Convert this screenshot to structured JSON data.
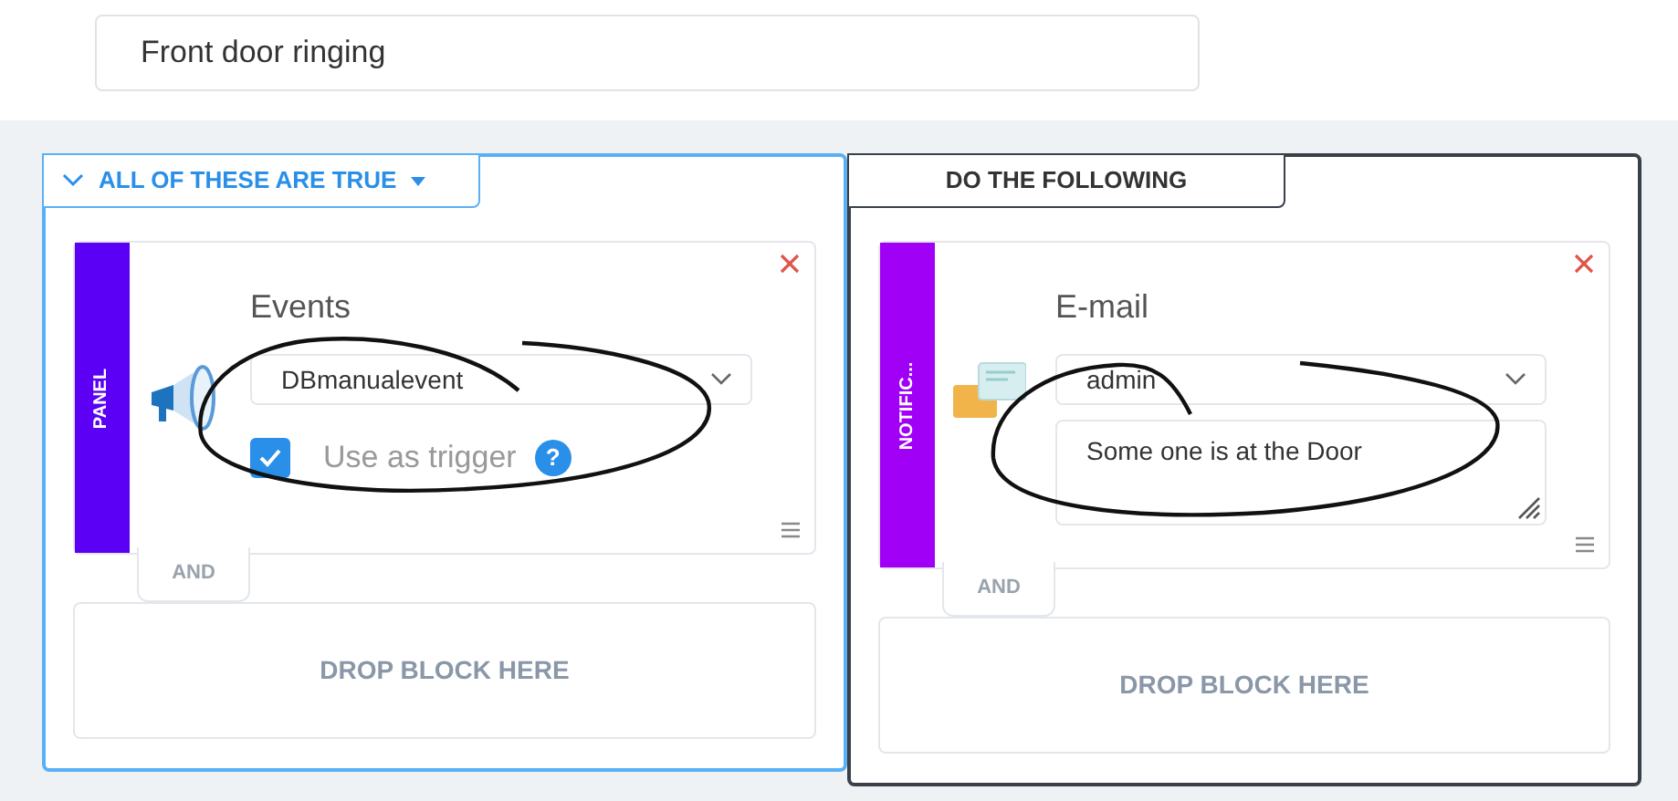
{
  "title_field": {
    "value": "Front door ringing"
  },
  "conditions": {
    "header": "ALL OF THESE ARE TRUE",
    "active": true,
    "blocks": [
      {
        "kind": "event",
        "category": "PANEL",
        "color": "#5b00f5",
        "title": "Events",
        "select": "DBmanualevent",
        "trigger": {
          "label": "Use as trigger",
          "checked": true,
          "help": "?"
        }
      }
    ],
    "connector": "AND",
    "drop_zone": "DROP BLOCK HERE"
  },
  "actions": {
    "header": "DO THE FOLLOWING",
    "active": false,
    "blocks": [
      {
        "kind": "email",
        "category": "NOTIFIC...",
        "color": "#a100f7",
        "title": "E-mail",
        "select": "admin",
        "message": "Some one is at the Door"
      }
    ],
    "connector": "AND",
    "drop_zone": "DROP BLOCK HERE"
  }
}
